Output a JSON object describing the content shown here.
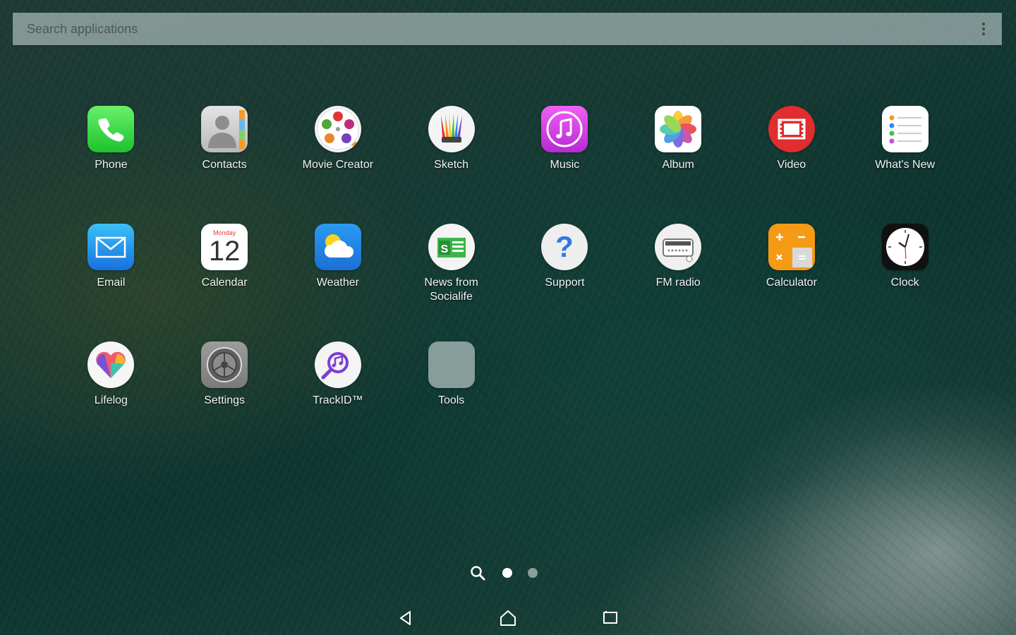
{
  "search": {
    "placeholder": "Search applications"
  },
  "apps": [
    {
      "label": "Phone",
      "icon": "phone-icon"
    },
    {
      "label": "Contacts",
      "icon": "contacts-icon"
    },
    {
      "label": "Movie Creator",
      "icon": "movie-creator-icon"
    },
    {
      "label": "Sketch",
      "icon": "sketch-icon"
    },
    {
      "label": "Music",
      "icon": "music-icon"
    },
    {
      "label": "Album",
      "icon": "album-icon"
    },
    {
      "label": "Video",
      "icon": "video-icon"
    },
    {
      "label": "What's New",
      "icon": "whats-new-icon"
    },
    {
      "label": "Email",
      "icon": "email-icon"
    },
    {
      "label": "Calendar",
      "icon": "calendar-icon",
      "month": "Monday",
      "day": "12"
    },
    {
      "label": "Weather",
      "icon": "weather-icon"
    },
    {
      "label": "News from\nSocialife",
      "icon": "socialife-icon"
    },
    {
      "label": "Support",
      "icon": "support-icon"
    },
    {
      "label": "FM radio",
      "icon": "fm-radio-icon"
    },
    {
      "label": "Calculator",
      "icon": "calculator-icon"
    },
    {
      "label": "Clock",
      "icon": "clock-icon"
    },
    {
      "label": "Lifelog",
      "icon": "lifelog-icon"
    },
    {
      "label": "Settings",
      "icon": "settings-icon"
    },
    {
      "label": "TrackID™",
      "icon": "trackid-icon"
    },
    {
      "label": "Tools",
      "icon": "folder-icon"
    }
  ],
  "pager": {
    "pages": 2,
    "current": 1
  },
  "colors": {
    "accent_phone": "#2ecc3f",
    "accent_music": "#d63be0",
    "accent_video": "#e32b2b",
    "accent_calculator": "#f59a14"
  }
}
